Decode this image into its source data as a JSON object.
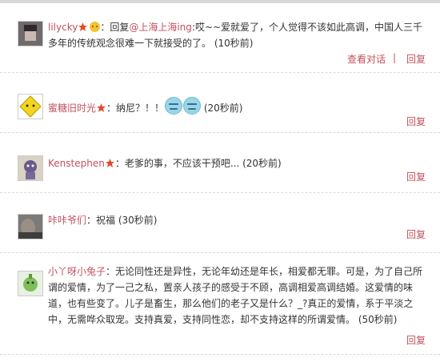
{
  "comments": [
    {
      "username": "lilycky",
      "text_pre": "：回复",
      "mention": "@上海上海ing",
      "text": ":哎~~爱就爱了，个人觉得不该如此高调，中国人三千多年的传统观念很难一下就接受的了。",
      "time": "(10秒前)",
      "view_conversation": "查看对话",
      "separator": "|",
      "reply": "回复"
    },
    {
      "username": "蜜糖旧时光",
      "text": "：纳尼？！！",
      "time": "(20秒前)",
      "reply": "回复"
    },
    {
      "username": "Kenstephen",
      "text": "：老爹的事，不应该干预吧...",
      "time": "(20秒前)",
      "reply": "回复"
    },
    {
      "username": "咔咔爷们",
      "text": "：祝福",
      "time": "(30秒前)",
      "reply": "回复"
    },
    {
      "username": "小丫呀小兔子",
      "text": "：无论同性还是异性，无论年幼还是年长，相爱都无罪。可是，为了自己所谓的爱情，为了一己之私，置亲人孩子的感受于不顾，高调相爱高调结婚。这爱情的味道，也有些变了。儿子是畜生，那么他们的老子又是什么？_?真正的爱情，系于平淡之中，无需哗众取宠。支持真爱，支持同性恋，却不支持这样的所谓爱情。",
      "time": "(50秒前)",
      "reply": "回复"
    }
  ],
  "colors": {
    "link": "#c2515e",
    "text": "#333333",
    "divider": "#d9d9d9"
  }
}
